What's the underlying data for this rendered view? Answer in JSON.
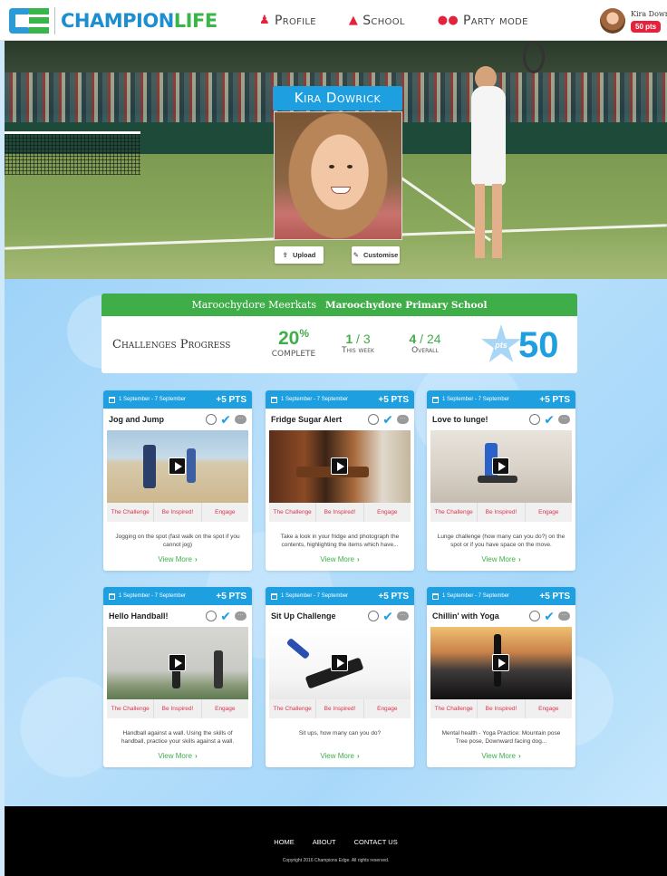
{
  "header": {
    "logo": {
      "part1": "CHAMPION",
      "part2": "LIFE"
    },
    "nav": [
      {
        "icon": "user-icon",
        "label": "Profile"
      },
      {
        "icon": "graduation-cap-icon",
        "label": "School"
      },
      {
        "icon": "mask-icon",
        "label": "Party mode"
      }
    ],
    "user": {
      "name": "Kira Dowrick",
      "points": "50 pts"
    }
  },
  "hero": {
    "name": "Kira Dowrick",
    "upload_label": "Upload",
    "customise_label": "Customise"
  },
  "progress": {
    "team": "Maroochydore Meerkats",
    "school": "Maroochydore Primary School",
    "title": "Challenges Progress",
    "percent": "20",
    "percent_sign": "%",
    "complete_label": "COMPLETE",
    "week_done": "1",
    "week_total": "3",
    "week_label": "This week",
    "overall_done": "4",
    "overall_total": "24",
    "overall_label": "Overall",
    "pts_label": "pts",
    "points": "50"
  },
  "tab_labels": [
    "The Challenge",
    "Be Inspired!",
    "Engage"
  ],
  "view_more_label": "View More",
  "cards": [
    {
      "date": "1 September - 7 September",
      "pts": "+5 PTS",
      "title": "Jog and Jump",
      "desc": "Jogging on the spot (fast walk on the spot if you cannot jog)",
      "media": "jog"
    },
    {
      "date": "1 September - 7 September",
      "pts": "+5 PTS",
      "title": "Fridge Sugar Alert",
      "desc": "Take a look in your fridge and photograph the contents, highlighting the items which have...",
      "media": "fridge"
    },
    {
      "date": "1 September - 7 September",
      "pts": "+5 PTS",
      "title": "Love to lunge!",
      "desc": "Lunge challenge (how many can you do?) on the spot or if you have space on the move.",
      "media": "lunge"
    },
    {
      "date": "1 September - 7 September",
      "pts": "+5 PTS",
      "title": "Hello Handball!",
      "desc": "Handball against a wall. Using the skills of handball, practice your skills against a wall.",
      "media": "hand"
    },
    {
      "date": "1 September - 7 September",
      "pts": "+5 PTS",
      "title": "Sit Up Challenge",
      "desc": "Sit ups, how many can you do?",
      "media": "situp"
    },
    {
      "date": "1 September - 7 September",
      "pts": "+5 PTS",
      "title": "Chillin' with Yoga",
      "desc": "Mental health - Yoga Practice: Mountain pose Tree pose, Downward facing dog...",
      "media": "yoga"
    }
  ],
  "footer": {
    "links": [
      "HOME",
      "ABOUT",
      "CONTACT US"
    ],
    "copyright": "Copyright 2016 Champions Edge. All rights reserved."
  },
  "colors": {
    "brand_blue": "#1e9fe0",
    "brand_green": "#3fae49",
    "accent_red": "#e5223b"
  }
}
